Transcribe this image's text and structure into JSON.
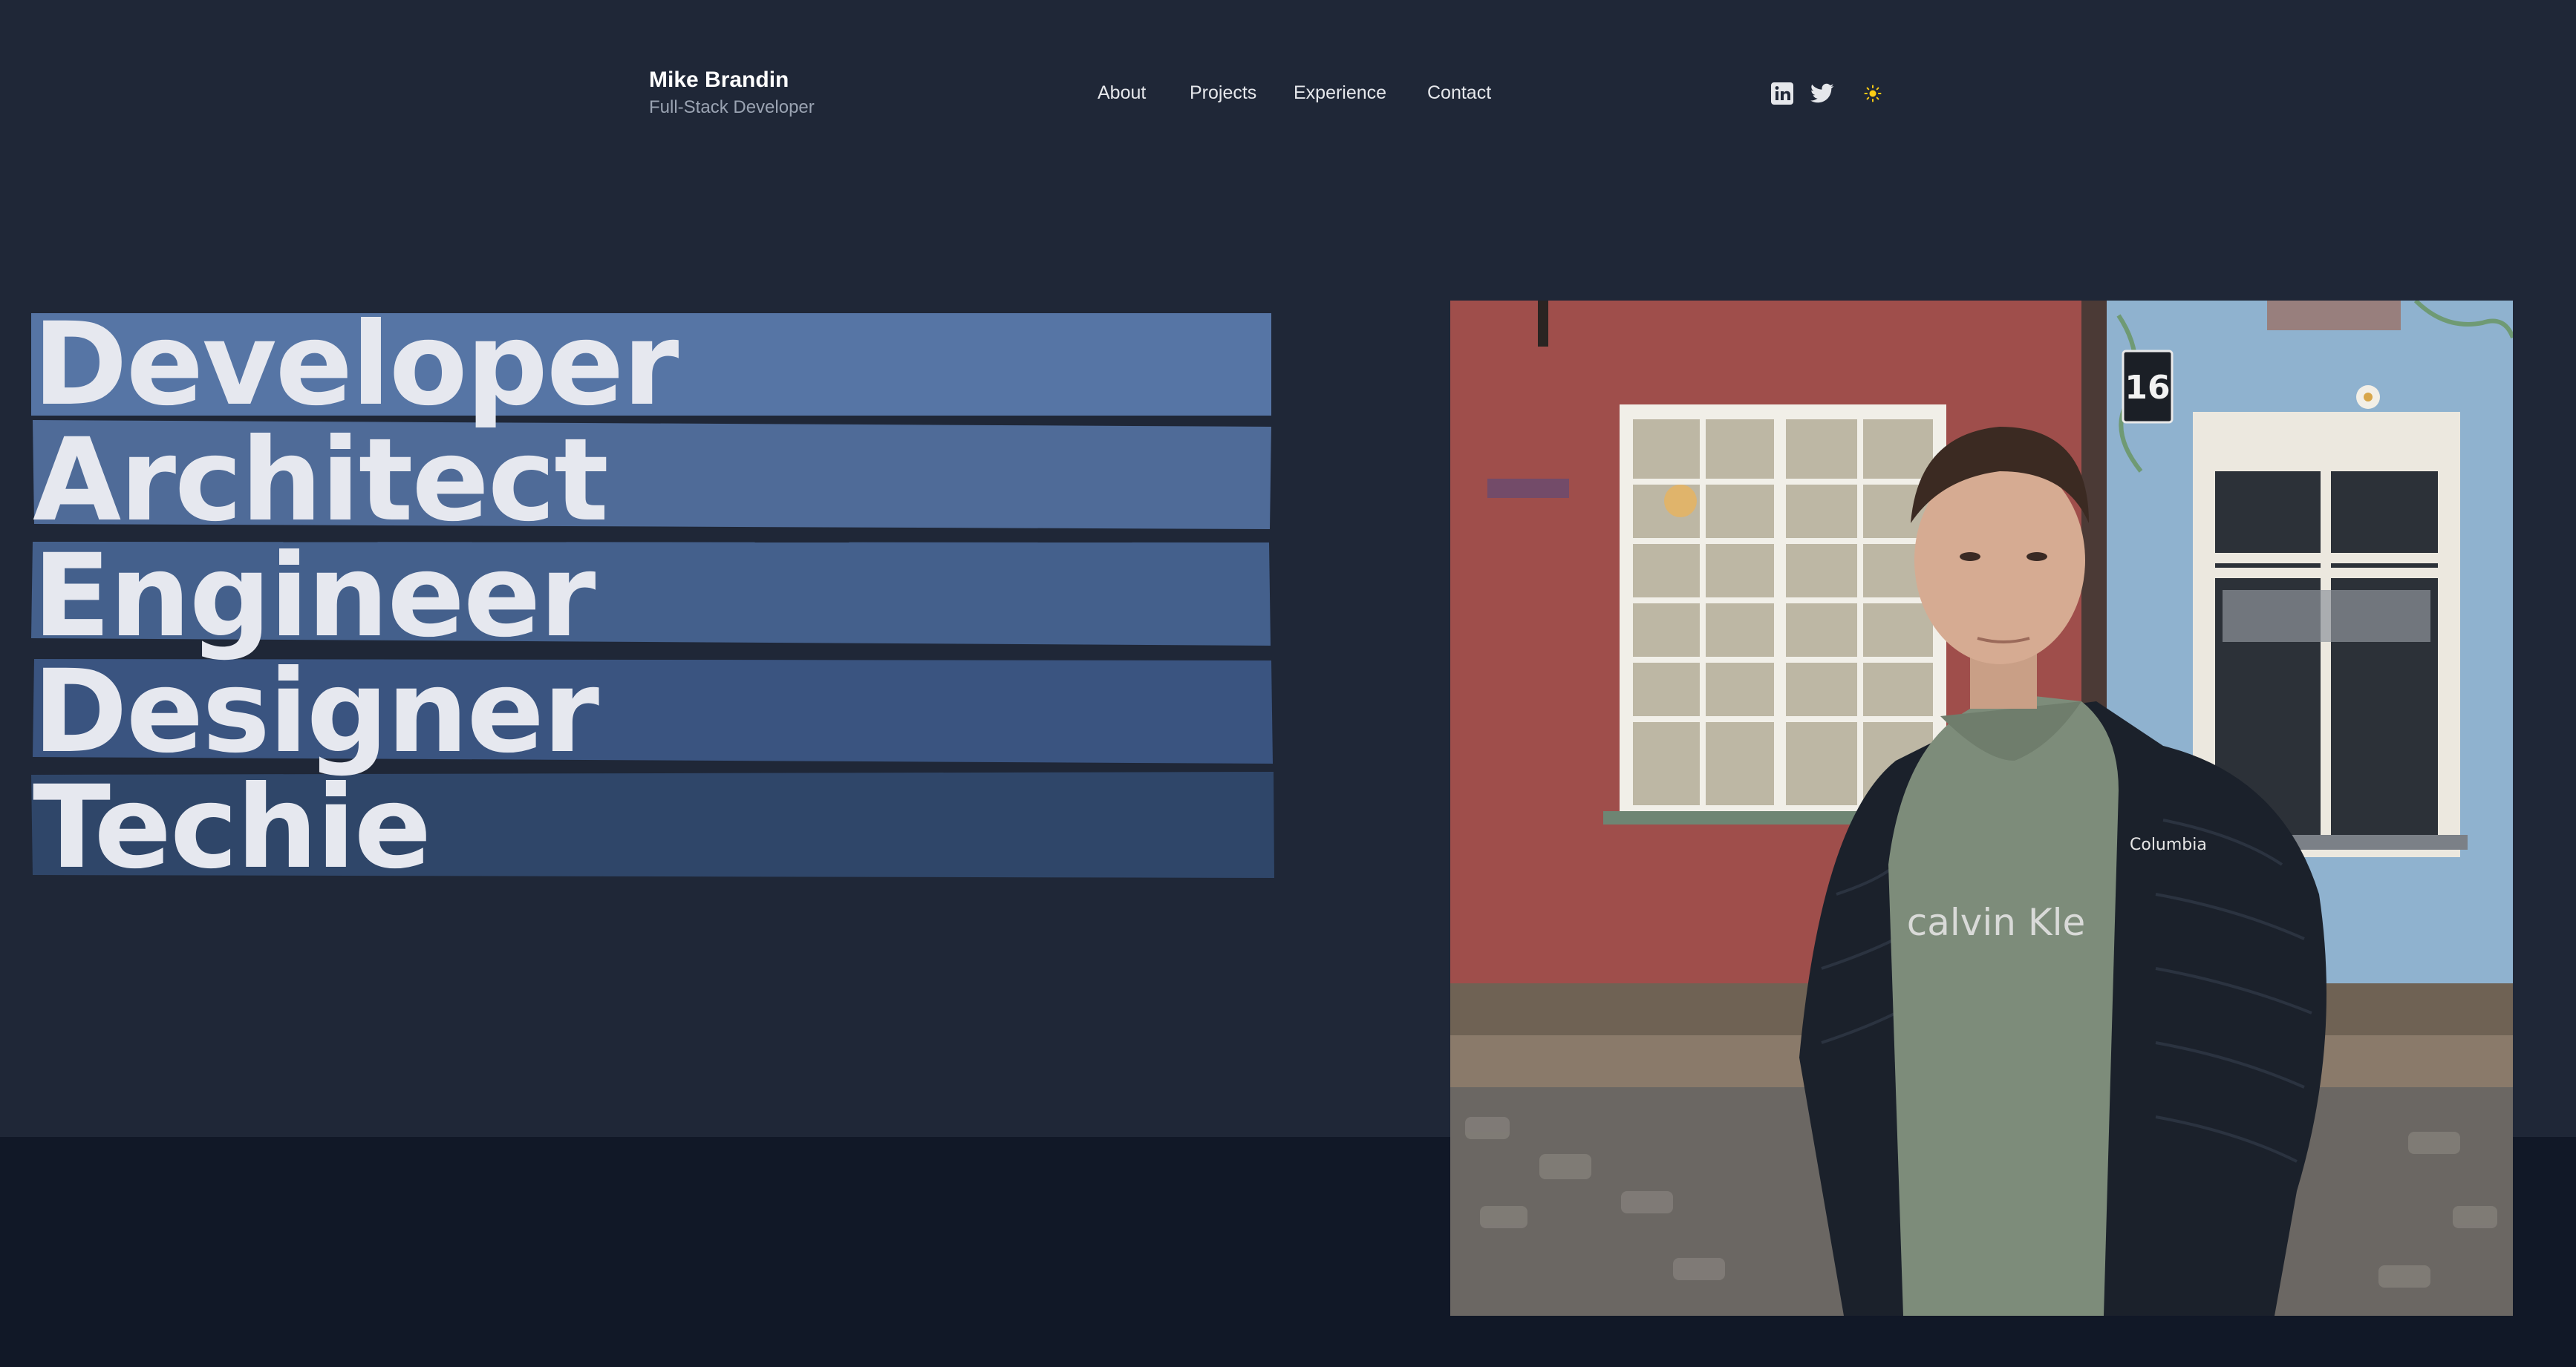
{
  "header": {
    "name": "Mike Brandin",
    "role": "Full-Stack Developer",
    "nav": [
      {
        "label": "About"
      },
      {
        "label": "Projects"
      },
      {
        "label": "Experience"
      },
      {
        "label": "Contact"
      }
    ],
    "icons": [
      "linkedin-icon",
      "twitter-icon",
      "sun-icon"
    ]
  },
  "hero": {
    "words": [
      "Developer",
      "Architect",
      "Engineer",
      "Designer",
      "Techie"
    ],
    "stripe_colors": [
      "#5675a5",
      "#4f6b98",
      "#44608c",
      "#3a5480",
      "#2f4669"
    ]
  },
  "photo": {
    "house_number": "16",
    "sweatshirt_text": "calvin Kle",
    "jacket_logo": "Columbia"
  },
  "colors": {
    "background": "#1f2737",
    "footer_band": "#111827",
    "text": "#e6e8ef",
    "accent_sun": "#facc15"
  }
}
